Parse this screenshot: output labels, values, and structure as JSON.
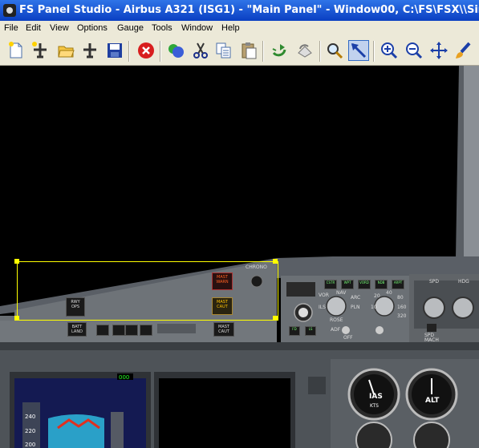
{
  "window": {
    "title": "FS Panel Studio - Airbus A321 (ISG1) - \"Main Panel\" - Window00, C:\\FS\\FSX\\\\SimObjects\\Airplanes"
  },
  "menu": [
    "File",
    "Edit",
    "View",
    "Options",
    "Gauge",
    "Tools",
    "Window",
    "Help"
  ],
  "toolbar": {
    "icons": [
      "new-panel-icon",
      "new-aircraft-icon",
      "open-folder-icon",
      "aircraft-icon",
      "save-icon",
      "delete-icon",
      "colors-icon",
      "cut-icon",
      "copy-icon",
      "paste-icon",
      "refresh-icon",
      "undo-icon",
      "magnify-icon",
      "select-arrow-icon",
      "zoom-in-icon",
      "zoom-out-icon",
      "move-icon",
      "brush-icon"
    ]
  },
  "panel": {
    "glareshield": {
      "rwy_ops": "RWY OPS",
      "mast_warn": "MAST WARN",
      "mast_caut": "MAST CAUT",
      "chrono": "CHRONO",
      "batt_land": "BATT LAND",
      "mast_caut_lower": "MAST CAUT"
    },
    "fcu": {
      "buttons": [
        "CSTR",
        "WPT",
        "VORD",
        "NDB",
        "ARPT"
      ],
      "small_buttons": [
        "FD",
        "LS"
      ],
      "mode_labels": [
        "VOR",
        "NAV",
        "ARC",
        "ILS",
        "PLN",
        "ROSE",
        "ADF",
        "OFF"
      ],
      "range_labels": [
        "20",
        "40",
        "80",
        "160",
        "320",
        "10"
      ],
      "spd_label": "SPD",
      "hdg_label": "HDG",
      "spd_mach": "SPD MACH"
    },
    "pfd": {
      "speed_marks": [
        "240",
        "220",
        "200"
      ],
      "green_readout": "000"
    },
    "standby": {
      "ias_label": "IAS",
      "kts_label": "KTS",
      "alt_label": "ALT"
    }
  },
  "colors": {
    "title_bar": "#0a3fc2",
    "menu_bg": "#ece9d8",
    "selection": "#ffff00",
    "panel_grey": "#6e7378"
  }
}
